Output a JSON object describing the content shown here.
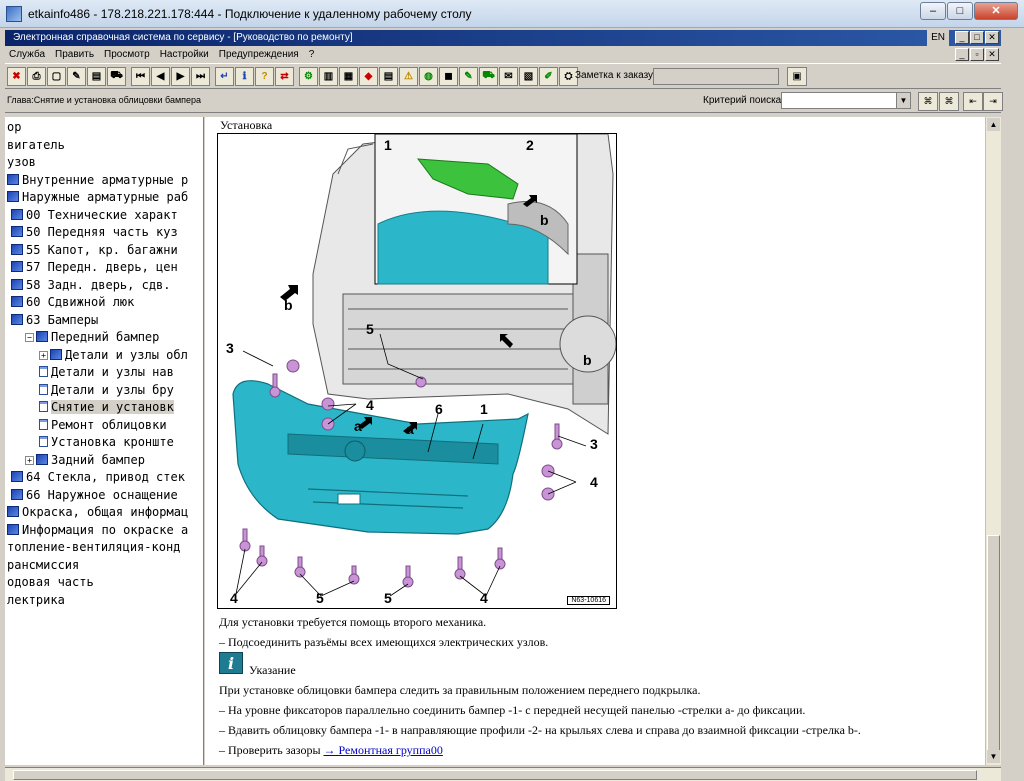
{
  "outer_window": {
    "title": "etkainfo486 - 178.218.221.178:444 - Подключение к удаленному рабочему столу"
  },
  "inner_window": {
    "title": "Электронная справочная система по сервису - [Руководство по ремонту]",
    "lang": "EN"
  },
  "menu": [
    "Служба",
    "Править",
    "Просмотр",
    "Настройки",
    "Предупреждения",
    "?"
  ],
  "toolbar": {
    "order_label": "Заметка к заказу:",
    "order_value": ""
  },
  "chapter": {
    "text": "Глава:Снятие и установка облицовки бампера",
    "criteria_label": "Критерий поиска:",
    "criteria_value": ""
  },
  "tree": [
    {
      "label": "ор",
      "indent": 0,
      "icon": "none",
      "toggle": ""
    },
    {
      "label": "вигатель",
      "indent": 0,
      "icon": "none",
      "toggle": ""
    },
    {
      "label": "узов",
      "indent": 0,
      "icon": "none",
      "toggle": ""
    },
    {
      "label": "Внутренние арматурные р",
      "indent": 0,
      "icon": "book",
      "toggle": ""
    },
    {
      "label": "Наружные арматурные раб",
      "indent": 0,
      "icon": "book",
      "toggle": ""
    },
    {
      "label": "00 Технические характ",
      "indent": 1,
      "icon": "book",
      "toggle": ""
    },
    {
      "label": "50 Передняя часть куз",
      "indent": 1,
      "icon": "book",
      "toggle": ""
    },
    {
      "label": "55 Капот, кр. багажни",
      "indent": 1,
      "icon": "book",
      "toggle": ""
    },
    {
      "label": "57 Передн. дверь, цен",
      "indent": 1,
      "icon": "book",
      "toggle": ""
    },
    {
      "label": "58 Задн. дверь, сдв.",
      "indent": 1,
      "icon": "book",
      "toggle": ""
    },
    {
      "label": "60 Сдвижной люк",
      "indent": 1,
      "icon": "book",
      "toggle": ""
    },
    {
      "label": "63 Бамперы",
      "indent": 1,
      "icon": "book",
      "toggle": ""
    },
    {
      "label": "Передний бампер",
      "indent": 2,
      "icon": "book",
      "toggle": "−"
    },
    {
      "label": "Детали и узлы обл",
      "indent": 3,
      "icon": "book",
      "toggle": "+"
    },
    {
      "label": "Детали и узлы нав",
      "indent": 3,
      "icon": "doc",
      "toggle": ""
    },
    {
      "label": "Детали и узлы бру",
      "indent": 3,
      "icon": "doc",
      "toggle": ""
    },
    {
      "label": "Снятие и установк",
      "indent": 3,
      "icon": "doc",
      "toggle": "",
      "selected": true
    },
    {
      "label": "Ремонт облицовки",
      "indent": 3,
      "icon": "doc",
      "toggle": ""
    },
    {
      "label": "Установка кронште",
      "indent": 3,
      "icon": "doc",
      "toggle": ""
    },
    {
      "label": "Задний бампер",
      "indent": 2,
      "icon": "book",
      "toggle": "+"
    },
    {
      "label": "64 Стекла, привод стек",
      "indent": 1,
      "icon": "book",
      "toggle": ""
    },
    {
      "label": "66 Наружное оснащение",
      "indent": 1,
      "icon": "book",
      "toggle": ""
    },
    {
      "label": "Окраска, общая информац",
      "indent": 0,
      "icon": "book",
      "toggle": ""
    },
    {
      "label": "Информация по окраске а",
      "indent": 0,
      "icon": "book",
      "toggle": ""
    },
    {
      "label": "топление-вентиляция-конд",
      "indent": 0,
      "icon": "none",
      "toggle": ""
    },
    {
      "label": "рансмиссия",
      "indent": 0,
      "icon": "none",
      "toggle": ""
    },
    {
      "label": "одовая часть",
      "indent": 0,
      "icon": "none",
      "toggle": ""
    },
    {
      "label": "лектрика",
      "indent": 0,
      "icon": "none",
      "toggle": ""
    }
  ],
  "content": {
    "section_title": "Установка",
    "figure_code": "N63-10616",
    "callouts": {
      "c1a": "1",
      "c2": "2",
      "cb1": "b",
      "cb2": "b",
      "cb3": "b",
      "c3a": "3",
      "c5a": "5",
      "c4a": "4",
      "c6": "6",
      "c1b": "1",
      "ca1": "a",
      "ca2": "a",
      "c3b": "3",
      "c4b": "4",
      "c4c": "4",
      "c5b": "5",
      "c5c": "5",
      "c4d": "4"
    },
    "p1": "Для установки требуется помощь второго механика.",
    "p2": "–  Подсоединить разъёмы всех имеющихся электрических узлов.",
    "note_label": "Указание",
    "p3": "При установке облицовки бампера следить за правильным положением переднего подкрылка.",
    "p4": "–  На уровне фиксаторов параллельно соединить бампер -1- с передней несущей панелью -стрелки а- до фиксации.",
    "p5": "–  Вдавить облицовку бампера -1- в направляющие профили -2- на крыльях слева и справа до взаимной фиксации -стрелка b-.",
    "p6_prefix": "–  Проверить зазоры ",
    "p6_link": "→ Ремонтная группа00"
  },
  "colors": {
    "bumper": "#2bb7c9",
    "guide": "#3cc23c",
    "fastener": "#c894d6",
    "title_bar": "#0a246a"
  }
}
